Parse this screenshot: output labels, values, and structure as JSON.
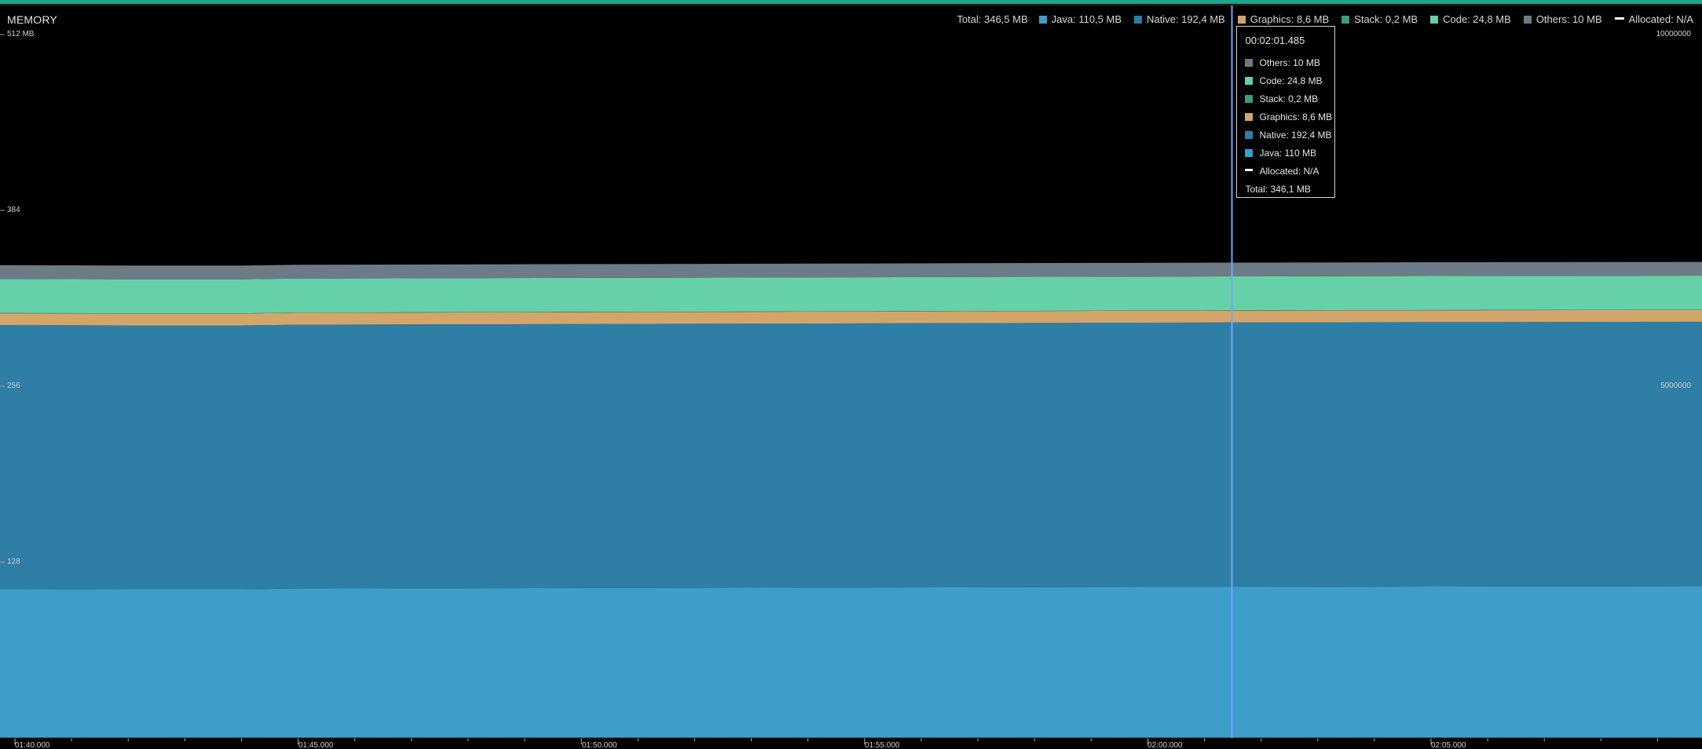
{
  "title": "MEMORY",
  "legend": {
    "total": "Total: 346,5 MB",
    "java": "Java: 110,5 MB",
    "native": "Native: 192,4 MB",
    "graphics": "Graphics: 8,6 MB",
    "stack": "Stack: 0,2 MB",
    "code": "Code: 24,8 MB",
    "others": "Others: 10 MB",
    "allocated": "Allocated: N/A"
  },
  "tooltip": {
    "time": "00:02:01.485",
    "others": "Others: 10 MB",
    "code": "Code: 24,8 MB",
    "stack": "Stack: 0,2 MB",
    "graphics": "Graphics: 8,6 MB",
    "native": "Native: 192,4 MB",
    "java": "Java: 110 MB",
    "allocated": "Allocated: N/A",
    "total": "Total: 346,1 MB"
  },
  "axes": {
    "left_ticks": [
      "512 MB",
      "384",
      "256",
      "128"
    ],
    "right_ticks": [
      "10000000",
      "5000000"
    ],
    "x_ticks": [
      "01:40.000",
      "01:45.000",
      "01:50.000",
      "01:55.000",
      "02:00.000",
      "02:05.000"
    ]
  },
  "colors": {
    "background": "#000000",
    "accent": "#1fa58a",
    "java": "#3f9dca",
    "native": "#2e7ea6",
    "graphics": "#d4a56a",
    "stack": "#3e9a7e",
    "code": "#66d0a8",
    "others": "#6c7b86",
    "cursor": "#6fa8ff"
  },
  "chart_data": {
    "type": "area",
    "stacked": true,
    "title": "MEMORY",
    "ylabel": "",
    "ylim": [
      0,
      512
    ],
    "x": [
      "01:39.000",
      "01:40.000",
      "01:42.000",
      "01:44.000",
      "01:45.000",
      "01:50.000",
      "01:55.000",
      "02:00.000",
      "02:01.485",
      "02:05.000",
      "02:09.000"
    ],
    "series": [
      {
        "name": "Java",
        "values": [
          108.5,
          108.5,
          108.3,
          108.3,
          108.8,
          109.2,
          109.6,
          110.0,
          110.0,
          110.3,
          110.5
        ]
      },
      {
        "name": "Native",
        "values": [
          192.0,
          192.0,
          192.0,
          192.0,
          192.0,
          192.1,
          192.2,
          192.3,
          192.4,
          192.4,
          192.4
        ]
      },
      {
        "name": "Graphics",
        "values": [
          8.6,
          8.6,
          8.6,
          8.6,
          8.6,
          8.6,
          8.6,
          8.6,
          8.6,
          8.6,
          8.6
        ]
      },
      {
        "name": "Stack",
        "values": [
          0.2,
          0.2,
          0.2,
          0.2,
          0.2,
          0.2,
          0.2,
          0.2,
          0.2,
          0.2,
          0.2
        ]
      },
      {
        "name": "Code",
        "values": [
          24.8,
          24.8,
          24.8,
          24.8,
          24.8,
          24.8,
          24.8,
          24.8,
          24.8,
          24.8,
          24.8
        ]
      },
      {
        "name": "Others",
        "values": [
          10.0,
          10.0,
          10.0,
          10.0,
          10.0,
          10.0,
          10.0,
          10.0,
          10.0,
          10.0,
          10.0
        ]
      }
    ],
    "cursor_x": "02:01.485",
    "secondary_ylim": [
      0,
      10000000
    ],
    "legend_position": "top-right",
    "grid": false
  }
}
